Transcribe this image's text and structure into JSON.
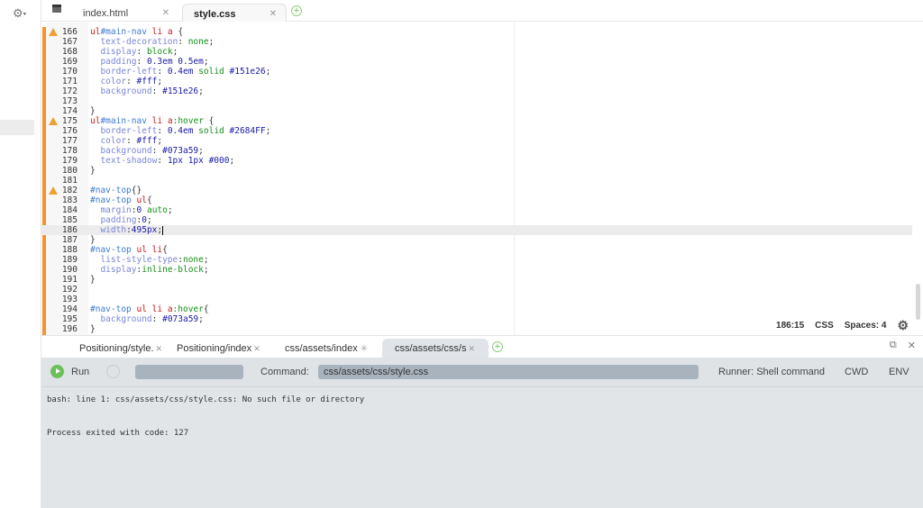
{
  "top_tabs": [
    {
      "label": "index.html",
      "active": false
    },
    {
      "label": "style.css",
      "active": true
    }
  ],
  "editor": {
    "current_line": 186,
    "warning_lines": [
      166,
      175,
      182
    ],
    "lines": [
      {
        "n": "166",
        "tokens": [
          [
            "s",
            "ul"
          ],
          [
            "i",
            "#main-nav"
          ],
          [
            "t",
            " "
          ],
          [
            "s",
            "li"
          ],
          [
            "t",
            " "
          ],
          [
            "s",
            "a"
          ],
          [
            "t",
            " {"
          ]
        ]
      },
      {
        "n": "167",
        "tokens": [
          [
            "t",
            "  "
          ],
          [
            "p",
            "text-decoration"
          ],
          [
            "t",
            ": "
          ],
          [
            "v",
            "none"
          ],
          [
            "t",
            ";"
          ]
        ]
      },
      {
        "n": "168",
        "tokens": [
          [
            "t",
            "  "
          ],
          [
            "p",
            "display"
          ],
          [
            "t",
            ": "
          ],
          [
            "v",
            "block"
          ],
          [
            "t",
            ";"
          ]
        ]
      },
      {
        "n": "169",
        "tokens": [
          [
            "t",
            "  "
          ],
          [
            "p",
            "padding"
          ],
          [
            "t",
            ": "
          ],
          [
            "n",
            "0.3em 0.5em"
          ],
          [
            "t",
            ";"
          ]
        ]
      },
      {
        "n": "170",
        "tokens": [
          [
            "t",
            "  "
          ],
          [
            "p",
            "border-left"
          ],
          [
            "t",
            ": "
          ],
          [
            "n",
            "0.4em"
          ],
          [
            "t",
            " "
          ],
          [
            "v",
            "solid"
          ],
          [
            "t",
            " "
          ],
          [
            "n",
            "#151e26"
          ],
          [
            "t",
            ";"
          ]
        ]
      },
      {
        "n": "171",
        "tokens": [
          [
            "t",
            "  "
          ],
          [
            "p",
            "color"
          ],
          [
            "t",
            ": "
          ],
          [
            "n",
            "#fff"
          ],
          [
            "t",
            ";"
          ]
        ]
      },
      {
        "n": "172",
        "tokens": [
          [
            "t",
            "  "
          ],
          [
            "p",
            "background"
          ],
          [
            "t",
            ": "
          ],
          [
            "n",
            "#151e26"
          ],
          [
            "t",
            ";"
          ]
        ]
      },
      {
        "n": "173",
        "tokens": []
      },
      {
        "n": "174",
        "tokens": [
          [
            "t",
            "}"
          ]
        ]
      },
      {
        "n": "175",
        "tokens": [
          [
            "s",
            "ul"
          ],
          [
            "i",
            "#main-nav"
          ],
          [
            "t",
            " "
          ],
          [
            "s",
            "li"
          ],
          [
            "t",
            " "
          ],
          [
            "s",
            "a"
          ],
          [
            "v",
            ":hover"
          ],
          [
            "t",
            " {"
          ]
        ]
      },
      {
        "n": "176",
        "tokens": [
          [
            "t",
            "  "
          ],
          [
            "p",
            "border-left"
          ],
          [
            "t",
            ": "
          ],
          [
            "n",
            "0.4em"
          ],
          [
            "t",
            " "
          ],
          [
            "v",
            "solid"
          ],
          [
            "t",
            " "
          ],
          [
            "n",
            "#2684FF"
          ],
          [
            "t",
            ";"
          ]
        ]
      },
      {
        "n": "177",
        "tokens": [
          [
            "t",
            "  "
          ],
          [
            "p",
            "color"
          ],
          [
            "t",
            ": "
          ],
          [
            "n",
            "#fff"
          ],
          [
            "t",
            ";"
          ]
        ]
      },
      {
        "n": "178",
        "tokens": [
          [
            "t",
            "  "
          ],
          [
            "p",
            "background"
          ],
          [
            "t",
            ": "
          ],
          [
            "n",
            "#073a59"
          ],
          [
            "t",
            ";"
          ]
        ]
      },
      {
        "n": "179",
        "tokens": [
          [
            "t",
            "  "
          ],
          [
            "p",
            "text-shadow"
          ],
          [
            "t",
            ": "
          ],
          [
            "n",
            "1px 1px #000"
          ],
          [
            "t",
            ";"
          ]
        ]
      },
      {
        "n": "180",
        "tokens": [
          [
            "t",
            "}"
          ]
        ]
      },
      {
        "n": "181",
        "tokens": []
      },
      {
        "n": "182",
        "tokens": [
          [
            "i",
            "#nav-top"
          ],
          [
            "t",
            "{}"
          ]
        ]
      },
      {
        "n": "183",
        "tokens": [
          [
            "i",
            "#nav-top"
          ],
          [
            "t",
            " "
          ],
          [
            "s",
            "ul"
          ],
          [
            "t",
            "{"
          ]
        ]
      },
      {
        "n": "184",
        "tokens": [
          [
            "t",
            "  "
          ],
          [
            "p",
            "margin"
          ],
          [
            "t",
            ":"
          ],
          [
            "n",
            "0"
          ],
          [
            "t",
            " "
          ],
          [
            "v",
            "auto"
          ],
          [
            "t",
            ";"
          ]
        ]
      },
      {
        "n": "185",
        "tokens": [
          [
            "t",
            "  "
          ],
          [
            "p",
            "padding"
          ],
          [
            "t",
            ":"
          ],
          [
            "n",
            "0"
          ],
          [
            "t",
            ";"
          ]
        ]
      },
      {
        "n": "186",
        "tokens": [
          [
            "t",
            "  "
          ],
          [
            "p",
            "width"
          ],
          [
            "t",
            ":"
          ],
          [
            "n",
            "495px"
          ],
          [
            "t",
            ";"
          ]
        ]
      },
      {
        "n": "187",
        "tokens": [
          [
            "t",
            "}"
          ]
        ]
      },
      {
        "n": "188",
        "tokens": [
          [
            "i",
            "#nav-top"
          ],
          [
            "t",
            " "
          ],
          [
            "s",
            "ul li"
          ],
          [
            "t",
            "{"
          ]
        ]
      },
      {
        "n": "189",
        "tokens": [
          [
            "t",
            "  "
          ],
          [
            "p",
            "list-style-type"
          ],
          [
            "t",
            ":"
          ],
          [
            "v",
            "none"
          ],
          [
            "t",
            ";"
          ]
        ]
      },
      {
        "n": "190",
        "tokens": [
          [
            "t",
            "  "
          ],
          [
            "p",
            "display"
          ],
          [
            "t",
            ":"
          ],
          [
            "v",
            "inline-block"
          ],
          [
            "t",
            ";"
          ]
        ]
      },
      {
        "n": "191",
        "tokens": [
          [
            "t",
            "}"
          ]
        ]
      },
      {
        "n": "192",
        "tokens": []
      },
      {
        "n": "193",
        "tokens": []
      },
      {
        "n": "194",
        "tokens": [
          [
            "i",
            "#nav-top"
          ],
          [
            "t",
            " "
          ],
          [
            "s",
            "ul li a"
          ],
          [
            "v",
            ":hover"
          ],
          [
            "t",
            "{"
          ]
        ]
      },
      {
        "n": "195",
        "tokens": [
          [
            "t",
            "  "
          ],
          [
            "p",
            "background"
          ],
          [
            "t",
            ": "
          ],
          [
            "n",
            "#073a59"
          ],
          [
            "t",
            ";"
          ]
        ]
      },
      {
        "n": "196",
        "tokens": [
          [
            "t",
            "}"
          ]
        ]
      }
    ]
  },
  "status": {
    "cursor": "186:15",
    "language": "CSS",
    "indent": "Spaces: 4"
  },
  "bottom_tabs": [
    {
      "label": "Positioning/style."
    },
    {
      "label": "Positioning/index"
    },
    {
      "label": "css/assets/index"
    },
    {
      "label": "css/assets/css/s"
    }
  ],
  "runbar": {
    "run": "Run",
    "command_label": "Command:",
    "command_value": "css/assets/css/style.css",
    "runner": "Runner: Shell command",
    "cwd": "CWD",
    "env": "ENV"
  },
  "output": [
    "bash: line 1: css/assets/css/style.css: No such file or directory",
    "Process exited with code: 127"
  ]
}
